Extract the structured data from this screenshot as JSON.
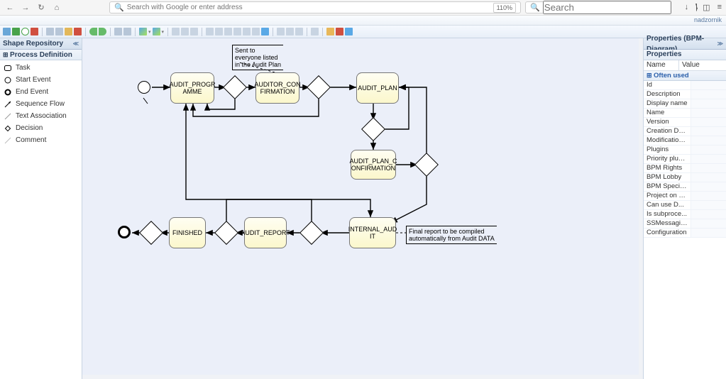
{
  "browser": {
    "url_placeholder": "Search with Google or enter address",
    "zoom": "110%",
    "search_placeholder": "Search",
    "user": "nadzornik"
  },
  "left_panel": {
    "title": "Shape Repository",
    "group": "Process Definition",
    "shapes": [
      {
        "label": "Task",
        "icon": "task"
      },
      {
        "label": "Start Event",
        "icon": "start"
      },
      {
        "label": "End Event",
        "icon": "end"
      },
      {
        "label": "Sequence Flow",
        "icon": "flow"
      },
      {
        "label": "Text Association",
        "icon": "assoc"
      },
      {
        "label": "Decision",
        "icon": "decision"
      },
      {
        "label": "Comment",
        "icon": "comment"
      }
    ]
  },
  "propsPanel": {
    "title": "Properties (BPM-Diagram)",
    "sub": "Properties",
    "col_name": "Name",
    "col_value": "Value",
    "group": "Often used",
    "rows": [
      "Id",
      "Description",
      "Display name",
      "Name",
      "Version",
      "Creation Date",
      "Modification...",
      "Plugins",
      "Priority plug...",
      "BPM Rights",
      "BPM Lobby",
      "BPM Specia...",
      "Project on p...",
      "Can use D...",
      "Is subproce...",
      "SSMessaging",
      "Configuration"
    ]
  },
  "nodes": {
    "audit_programme": "AUDIT_PROGR\nAMME",
    "auditor_confirm": "AUDITOR_CON\nFIRMATION",
    "audit_plan": "AUDIT_PLAN",
    "audit_plan_conf": "AUDIT_PLAN_C\nONFIRMATION",
    "internal_audit": "INTERNAL_AUD\nIT",
    "audit_report": "AUDIT_REPORT",
    "finished": "FINISHED"
  },
  "annotations": {
    "a1": "Sent to\neveryone listed\nin the Audit Plan",
    "a2": "Final report to be compiled\nautomatically from Audit DATA"
  },
  "chart_data": {
    "type": "diagram",
    "diagram_kind": "bpmn-process",
    "events": [
      {
        "id": "start1",
        "type": "start"
      },
      {
        "id": "end1",
        "type": "end"
      }
    ],
    "gateways": [
      "g1",
      "g2",
      "g3",
      "g4",
      "g5",
      "g6",
      "g7"
    ],
    "tasks": [
      "AUDIT_PROGRAMME",
      "AUDITOR_CONFIRMATION",
      "AUDIT_PLAN",
      "AUDIT_PLAN_CONFIRMATION",
      "INTERNAL_AUDIT",
      "AUDIT_REPORT",
      "FINISHED"
    ],
    "sequence_flows": [
      [
        "start1",
        "AUDIT_PROGRAMME"
      ],
      [
        "AUDIT_PROGRAMME",
        "g1"
      ],
      [
        "g1",
        "AUDITOR_CONFIRMATION"
      ],
      [
        "AUDITOR_CONFIRMATION",
        "g2"
      ],
      [
        "g2",
        "AUDIT_PLAN"
      ],
      [
        "g2",
        "AUDIT_PROGRAMME"
      ],
      [
        "AUDIT_PLAN",
        "g3"
      ],
      [
        "g3",
        "AUDIT_PLAN_CONFIRMATION"
      ],
      [
        "g3",
        "AUDIT_PLAN"
      ],
      [
        "AUDIT_PLAN_CONFIRMATION",
        "g4"
      ],
      [
        "g4",
        "INTERNAL_AUDIT"
      ],
      [
        "g4",
        "AUDIT_PLAN"
      ],
      [
        "INTERNAL_AUDIT",
        "g5"
      ],
      [
        "g5",
        "AUDIT_REPORT"
      ],
      [
        "g5",
        "AUDIT_PROGRAMME"
      ],
      [
        "AUDIT_REPORT",
        "g6"
      ],
      [
        "g6",
        "FINISHED"
      ],
      [
        "g6",
        "INTERNAL_AUDIT"
      ],
      [
        "FINISHED",
        "g7"
      ],
      [
        "g7",
        "end1"
      ]
    ],
    "text_annotations": [
      {
        "text": "Sent to everyone listed in the Audit Plan",
        "attached_to": "AUDITOR_CONFIRMATION"
      },
      {
        "text": "Final report to be compiled automatically from Audit DATA",
        "attached_to": "INTERNAL_AUDIT"
      }
    ]
  }
}
